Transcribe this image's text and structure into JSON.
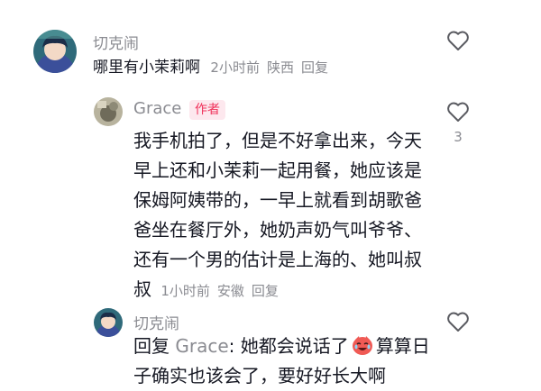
{
  "comments": [
    {
      "username": "切克闹",
      "text": "哪里有小茉莉啊",
      "time": "2小时前",
      "location": "陕西",
      "reply_label": "回复",
      "likes": ""
    },
    {
      "username": "Grace",
      "author_tag": "作者",
      "lines": [
        "我手机拍了，但是不好拿出来，今天",
        "早上还和小茉莉一起用餐，她应该是",
        "保姆阿姨带的，一早上就看到胡歌爸",
        "爸坐在餐厅外，她奶声奶气叫爷爷、",
        "还有一个男的估计是上海的、她叫叔"
      ],
      "last_line": "叔",
      "time": "1小时前",
      "location": "安徽",
      "reply_label": "回复",
      "likes": "3"
    },
    {
      "username": "切克闹",
      "reply_prefix": "回复",
      "reply_target": "Grace",
      "line1_text": ": 她都会说话了",
      "line1_after": "算算日",
      "line2": "子确实也该会了，要好好长大啊",
      "sticker": "laughing-crying-emoji",
      "likes": ""
    }
  ]
}
